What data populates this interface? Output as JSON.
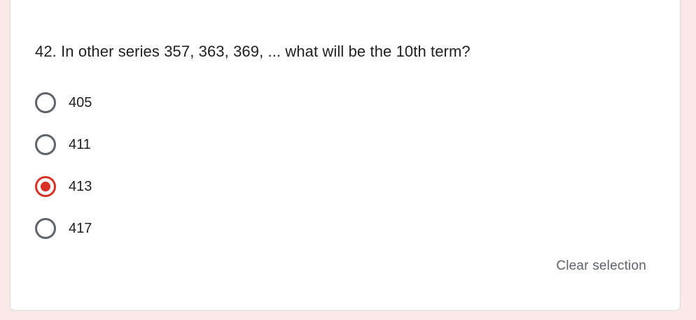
{
  "question": {
    "text": "42. In other series 357, 363, 369, ... what will be the 10th term?"
  },
  "options": [
    {
      "label": "405",
      "selected": false
    },
    {
      "label": "411",
      "selected": false
    },
    {
      "label": "413",
      "selected": true
    },
    {
      "label": "417",
      "selected": false
    }
  ],
  "actions": {
    "clear_label": "Clear selection"
  },
  "colors": {
    "page_background": "#fbe9e7",
    "card_background": "#ffffff",
    "radio_unselected": "#5f6368",
    "radio_selected": "#d93025",
    "text_primary": "#202124",
    "text_secondary": "#5f6368"
  }
}
